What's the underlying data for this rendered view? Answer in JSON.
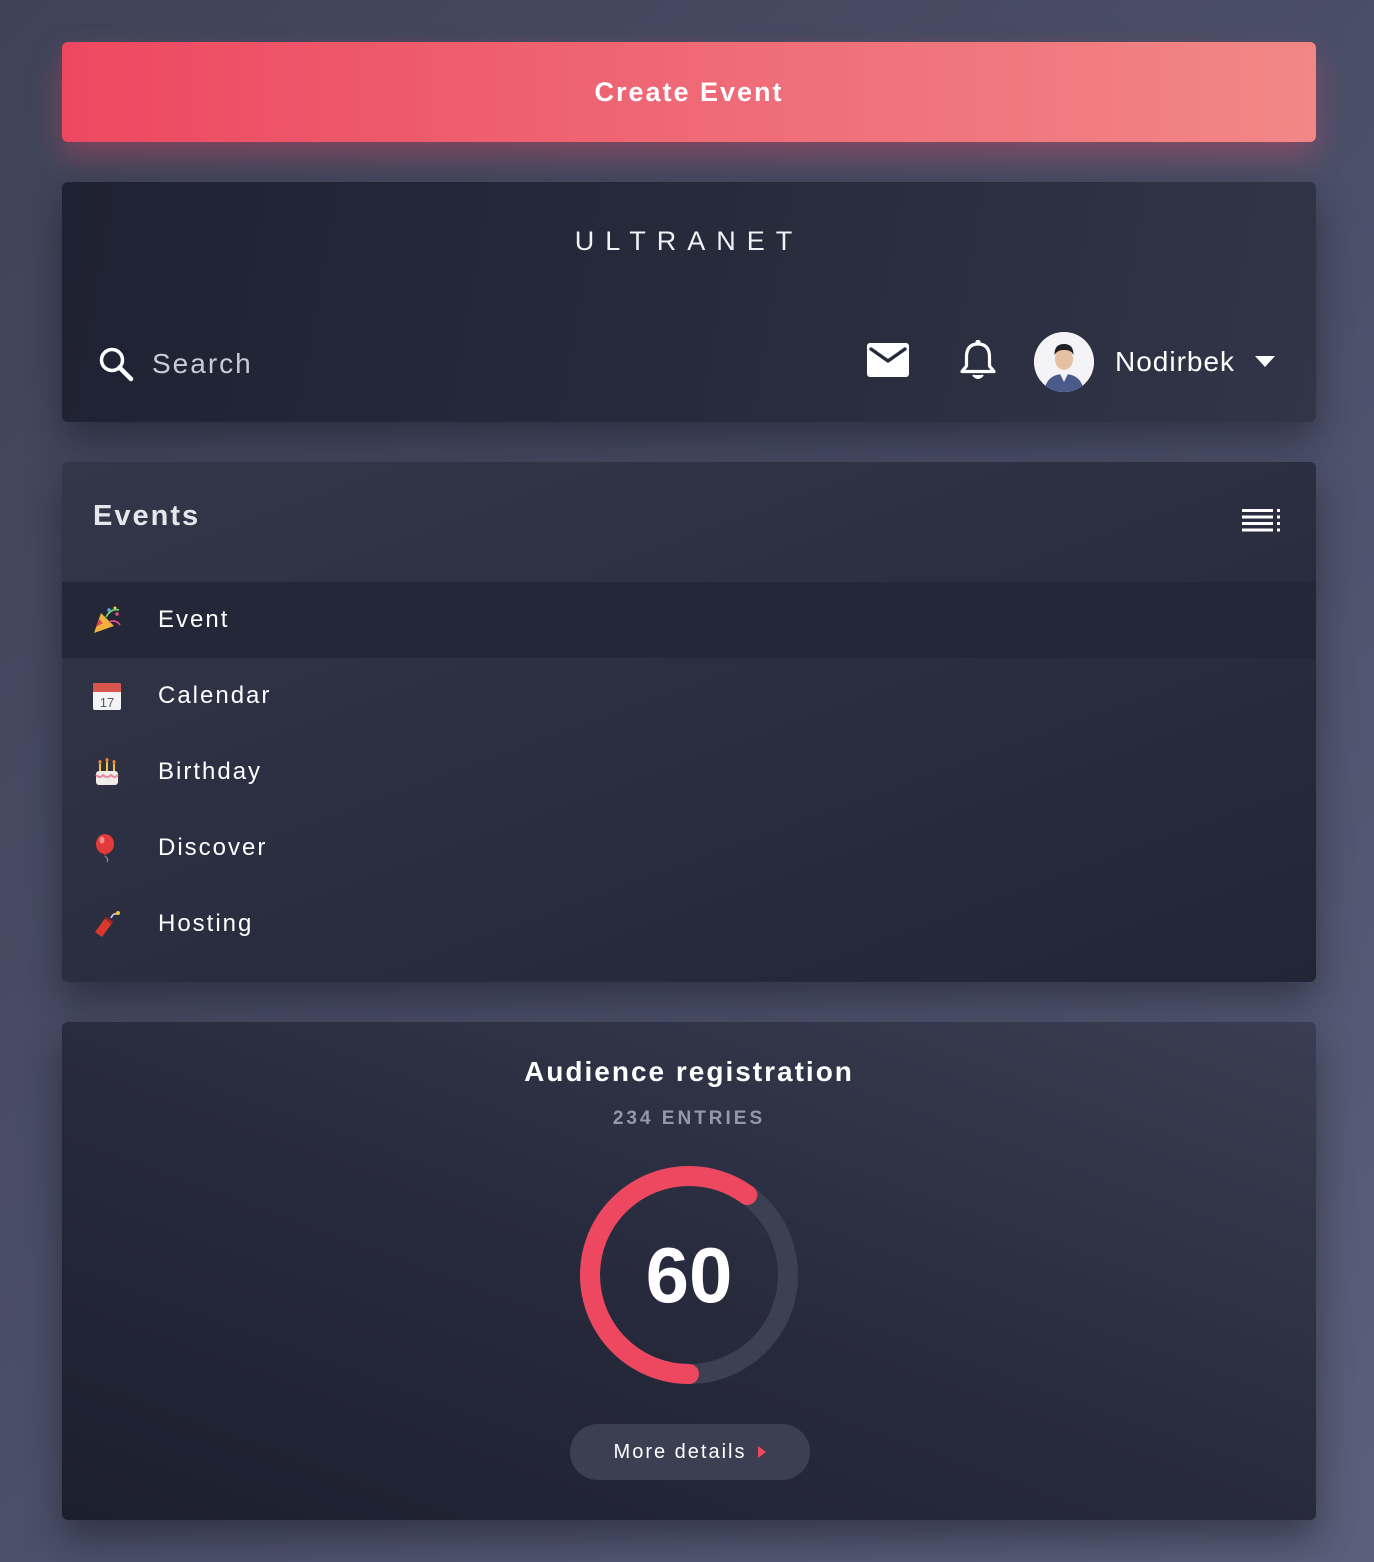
{
  "create_button": {
    "label": "Create Event"
  },
  "header": {
    "brand": "ULTRANET",
    "search": {
      "placeholder": "Search",
      "value": ""
    },
    "icons": [
      "search-icon",
      "mail-icon",
      "bell-icon",
      "caret-down-icon"
    ],
    "user": {
      "name": "Nodirbek"
    }
  },
  "events": {
    "title": "Events",
    "menu_icon": "list-menu-icon",
    "items": [
      {
        "label": "Event",
        "icon": "party-popper-icon",
        "active": true
      },
      {
        "label": "Calendar",
        "icon": "calendar-icon",
        "active": false
      },
      {
        "label": "Birthday",
        "icon": "birthday-cake-icon",
        "active": false
      },
      {
        "label": "Discover",
        "icon": "balloon-icon",
        "active": false
      },
      {
        "label": "Hosting",
        "icon": "firecracker-icon",
        "active": false
      }
    ]
  },
  "audience": {
    "title": "Audience registration",
    "entries": "234 ENTRIES",
    "value": "60",
    "progress_fraction": 0.6,
    "button_label": "More details"
  },
  "colors": {
    "accent": "#ee4861",
    "accent_light": "#f28786",
    "card_dark": "#242737",
    "track": "#3c4052",
    "muted_text": "#9598a6"
  }
}
